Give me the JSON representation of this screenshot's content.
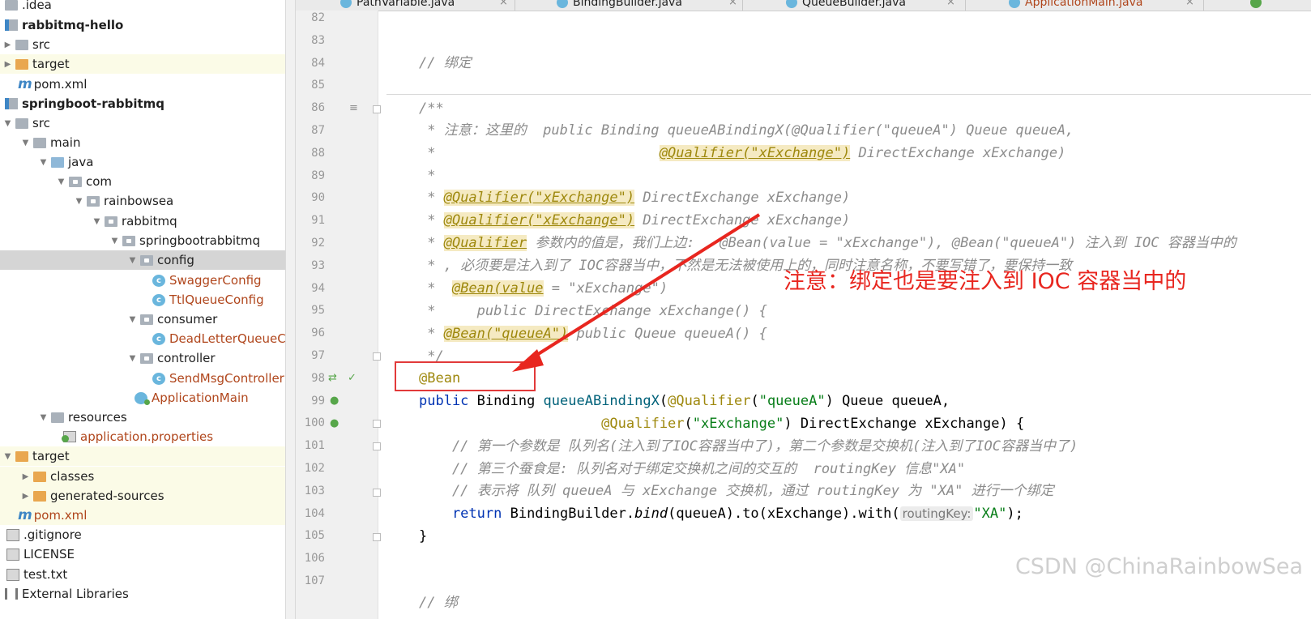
{
  "tabs": [
    {
      "label": "PathVariable.java",
      "active": false
    },
    {
      "label": "BindingBuilder.java",
      "active": false
    },
    {
      "label": "QueueBuilder.java",
      "active": false
    },
    {
      "label": "ApplicationMain.java",
      "active": true
    }
  ],
  "tree": [
    {
      "label": ".idea",
      "icon": "folder-icon"
    },
    {
      "label": "rabbitmq-hello",
      "icon": "module-icon"
    },
    {
      "label": "src",
      "icon": "folder-icon"
    },
    {
      "label": "target",
      "icon": "folder-icon"
    },
    {
      "label": "pom.xml",
      "icon": "maven-icon"
    },
    {
      "label": "springboot-rabbitmq",
      "icon": "module-icon"
    },
    {
      "label": "src",
      "icon": "folder-icon"
    },
    {
      "label": "main",
      "icon": "folder-icon"
    },
    {
      "label": "java",
      "icon": "source-folder-icon"
    },
    {
      "label": "com",
      "icon": "package-icon"
    },
    {
      "label": "rainbowsea",
      "icon": "package-icon"
    },
    {
      "label": "rabbitmq",
      "icon": "package-icon"
    },
    {
      "label": "springbootrabbitmq",
      "icon": "package-icon"
    },
    {
      "label": "config",
      "icon": "package-icon"
    },
    {
      "label": "SwaggerConfig",
      "icon": "class-icon"
    },
    {
      "label": "TtlQueueConfig",
      "icon": "class-icon"
    },
    {
      "label": "consumer",
      "icon": "package-icon"
    },
    {
      "label": "DeadLetterQueueConsumer",
      "icon": "class-icon"
    },
    {
      "label": "controller",
      "icon": "package-icon"
    },
    {
      "label": "SendMsgController",
      "icon": "class-icon"
    },
    {
      "label": "ApplicationMain",
      "icon": "spring-app-icon"
    },
    {
      "label": "resources",
      "icon": "resources-folder-icon"
    },
    {
      "label": "application.properties",
      "icon": "properties-icon"
    },
    {
      "label": "target",
      "icon": "folder-icon"
    },
    {
      "label": "classes",
      "icon": "folder-icon"
    },
    {
      "label": "generated-sources",
      "icon": "folder-icon"
    },
    {
      "label": "pom.xml",
      "icon": "maven-icon"
    },
    {
      "label": ".gitignore",
      "icon": "file-icon"
    },
    {
      "label": "LICENSE",
      "icon": "file-icon"
    },
    {
      "label": "test.txt",
      "icon": "file-icon"
    },
    {
      "label": "External Libraries",
      "icon": "library-icon"
    }
  ],
  "line_numbers": [
    "82",
    "83",
    "84",
    "85",
    "86",
    "87",
    "88",
    "89",
    "90",
    "91",
    "92",
    "93",
    "94",
    "95",
    "96",
    "97",
    "98",
    "99",
    "100",
    "101",
    "102",
    "103",
    "104",
    "105",
    "106",
    "107"
  ],
  "code": {
    "l84": "// 绑定",
    "l86": "/**",
    "l87": " * 注意：这里的  public Binding queueABindingX(@Qualifier(\"queueA\") Queue queueA,",
    "l88a": " *                           ",
    "l88b": "@Qualifier(\"xExchange\")",
    "l88c": " DirectExchange xExchange)",
    "l89": " *",
    "l90a": " * ",
    "l90b": "@Qualifier(\"xExchange\")",
    "l90c": " DirectExchange xExchange)",
    "l91a": " * ",
    "l91b": "@Qualifier(\"xExchange\")",
    "l91c": " DirectExchange xExchange)",
    "l92a": " * ",
    "l92b": "@Qualifier",
    "l92c": " 参数内的值是，我们上边:   @Bean(value = \"xExchange\"), @Bean(\"queueA\") 注入到 IOC 容器当中的",
    "l93": " * , 必须要是注入到了 IOC容器当中，不然是无法被使用上的，同时注意名称，不要写错了，要保持一致",
    "l94a": " *  ",
    "l94b": "@Bean(value",
    "l94c": " = \"xExchange\")",
    "l95": " *     public DirectExchange xExchange() {",
    "l96a": " * ",
    "l96b": "@Bean(\"queueA\")",
    "l96c": " public Queue queueA() {",
    "l97": " */",
    "l98": "@Bean",
    "l99_kw": "public",
    "l99_type": " Binding ",
    "l99_fn": "queueABindingX",
    "l99_p1": "(",
    "l99_ann": "@Qualifier",
    "l99_p2": "(",
    "l99_str": "\"queueA\"",
    "l99_p3": ") Queue queueA,",
    "l100_pad": "                      ",
    "l100_ann": "@Qualifier",
    "l100_p1": "(",
    "l100_str": "\"xExchange\"",
    "l100_p2": ") DirectExchange xExchange) {",
    "l101": "    // 第一个参数是 队列名(注入到了IOC容器当中了)，第二个参数是交换机(注入到了IOC容器当中了)",
    "l102": "    // 第三个蚕食是: 队列名对于绑定交换机之间的交互的  routingKey 信息\"XA\"",
    "l103": "    // 表示将 队列 queueA 与 xExchange 交换机，通过 routingKey 为 \"XA\" 进行一个绑定",
    "l104_ret": "    return",
    "l104_a": " BindingBuilder.",
    "l104_bind": "bind",
    "l104_b": "(queueA).to(xExchange).with(",
    "l104_hint": "routingKey:",
    "l104_str": "\"XA\"",
    "l104_c": ");",
    "l105": "}",
    "l107": "// 绑"
  },
  "annotation_note": "注意：绑定也是要注入到 IOC 容器当中的",
  "watermark": "CSDN @ChinaRainbowSea",
  "colors": {
    "keyword": "#0033b3",
    "string": "#067d17",
    "comment": "#8c8c8c",
    "annotation": "#9e880d",
    "note_red": "#e8261f"
  }
}
